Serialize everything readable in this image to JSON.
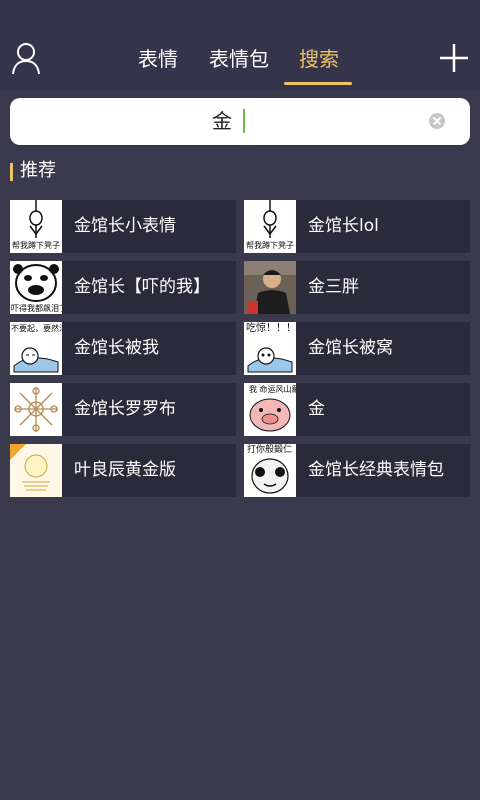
{
  "header": {
    "tabs": [
      {
        "label": "表情"
      },
      {
        "label": "表情包"
      },
      {
        "label": "搜索"
      }
    ],
    "active_color": "#e9c46a",
    "profile_icon": "user-icon",
    "add_icon": "plus-icon"
  },
  "search": {
    "value": "金",
    "clear_icon": "clear-icon"
  },
  "section": {
    "title": "推荐"
  },
  "results": [
    {
      "label": "金馆长小表情",
      "thumb_caption": "帮我蹲下凳子"
    },
    {
      "label": "金馆长lol",
      "thumb_caption": "帮我蹲下凳子"
    },
    {
      "label": "金馆长【吓的我】",
      "thumb_caption": "吓得我都飙泪了"
    },
    {
      "label": "金三胖",
      "thumb_caption": ""
    },
    {
      "label": "金馆长被我",
      "thumb_caption": "不要起，要然活结我"
    },
    {
      "label": "金馆长被窝",
      "thumb_caption": "吃惊！！！"
    },
    {
      "label": "金馆长罗罗布",
      "thumb_caption": ""
    },
    {
      "label": "金",
      "thumb_caption": "我 命运风山羅"
    },
    {
      "label": "叶良辰黄金版",
      "thumb_caption": ""
    },
    {
      "label": "金馆长经典表情包",
      "thumb_caption": "打你般鍛仁"
    }
  ]
}
